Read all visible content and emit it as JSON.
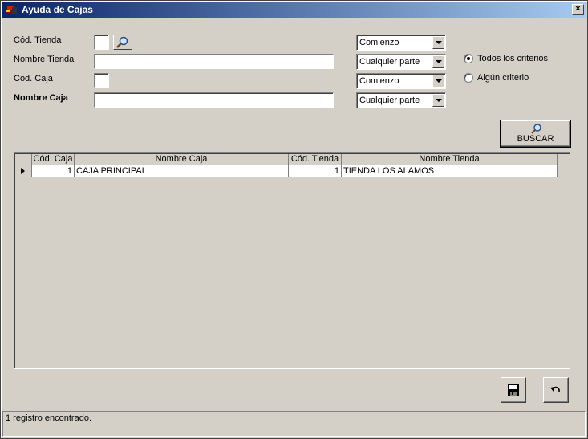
{
  "window": {
    "title": "Ayuda de Cajas",
    "close_label": "×"
  },
  "form": {
    "cod_tienda": {
      "label": "Cód. Tienda",
      "value": ""
    },
    "nombre_tienda": {
      "label": "Nombre Tienda",
      "value": ""
    },
    "cod_caja": {
      "label": "Cód. Caja",
      "value": ""
    },
    "nombre_caja": {
      "label": "Nombre Caja",
      "value": ""
    },
    "combos": [
      {
        "selected": "Comienzo"
      },
      {
        "selected": "Cualquier parte"
      },
      {
        "selected": "Comienzo"
      },
      {
        "selected": "Cualquier parte"
      }
    ],
    "radios": [
      {
        "label": "Todos los criterios",
        "checked": true
      },
      {
        "label": "Algún criterio",
        "checked": false
      }
    ],
    "buscar_label": "BUSCAR"
  },
  "grid": {
    "columns": [
      "Cód. Caja",
      "Nombre Caja",
      "Cód. Tienda",
      "Nombre Tienda"
    ],
    "rows": [
      {
        "cod_caja": "1",
        "nombre_caja": "CAJA PRINCIPAL",
        "cod_tienda": "1",
        "nombre_tienda": "TIENDA LOS ALAMOS"
      }
    ]
  },
  "actions": {
    "save_icon": "floppy-disk-icon",
    "undo_icon": "undo-arrow-icon"
  },
  "status": {
    "text": "1 registro encontrado."
  }
}
